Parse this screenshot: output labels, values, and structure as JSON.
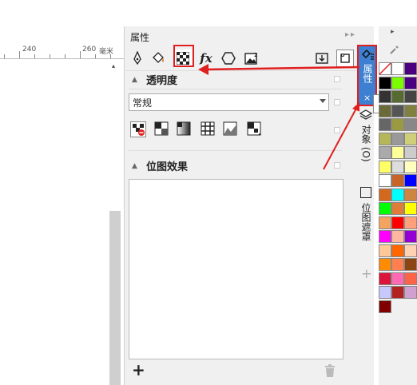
{
  "ruler": {
    "label_240": "240",
    "label_260": "260",
    "unit": "毫米"
  },
  "docker": {
    "title": "属性",
    "controls": "▸▸ ×",
    "toolbar_icons": [
      "outline-pen-icon",
      "fill-icon",
      "transparency-icon",
      "effects-fx-icon",
      "hexagon-icon",
      "bitmap-image-icon",
      "export-icon",
      "frame-icon"
    ]
  },
  "transparency": {
    "heading": "透明度",
    "blend_mode": "常规",
    "types": [
      "no-transparency",
      "uniform",
      "fountain",
      "vector-pattern",
      "bitmap-pattern",
      "two-color-pattern"
    ]
  },
  "bitmap_effects": {
    "heading": "位图效果"
  },
  "vtabs": {
    "properties": "属性",
    "properties_close": "×",
    "objects": "对象 (O)",
    "bitmap_mask": "位图遮罩",
    "add": "+"
  },
  "tooltip": "属性",
  "colors": {
    "accent_blue": "#3d7fd1",
    "highlight_red": "#e02020"
  },
  "palette": [
    "#ffffff",
    "#4b0082",
    "#000000",
    "#7cfc00",
    "#4b0082",
    "#333333",
    "#556b2f",
    "#444444",
    "#6b6b3a",
    "#555555",
    "#808040",
    "#666666",
    "#9a9a40",
    "#888888",
    "#b5b55a",
    "#999999",
    "#cfcf7a",
    "#aaaaaa",
    "#ffff99",
    "#cccccc",
    "#ffff66",
    "#dddddd",
    "#ffffc0",
    "#ffffff",
    "#c86428",
    "#0000ff",
    "#d2691e",
    "#00ffff",
    "#cd853f",
    "#00ff00",
    "#e07b39",
    "#ffff00",
    "#f4a460",
    "#ff0000",
    "#ffa07a",
    "#ff00ff",
    "#ffb6a0",
    "#9400d3",
    "#ffc896",
    "#ff6600",
    "#ffd2b4",
    "#ff8c00",
    "#ff7f50",
    "#8b4513",
    "#dc143c",
    "#ff69b4",
    "#ff6347",
    "#c8c8ff",
    "#b22222",
    "#d0a0d0",
    "#800000"
  ]
}
